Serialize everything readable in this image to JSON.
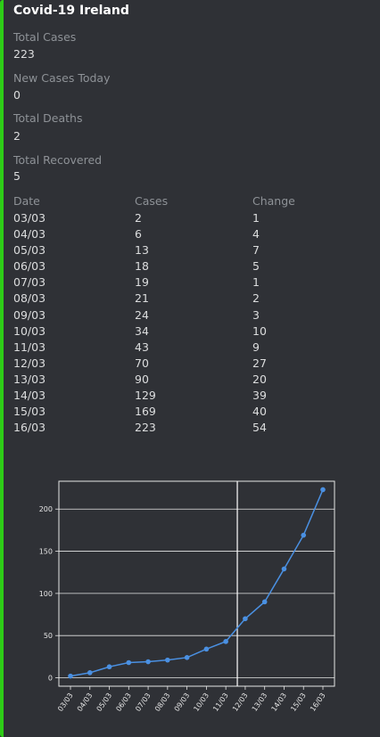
{
  "colors": {
    "accent": "#2ecc17",
    "background": "#2f3136",
    "field_label": "#8e9297",
    "text": "#dcddde",
    "line": "#4a90e2"
  },
  "embed": {
    "title": "Covid-19 Ireland",
    "fields": [
      {
        "name": "Total Cases",
        "value": "223"
      },
      {
        "name": "New Cases Today",
        "value": "0"
      },
      {
        "name": "Total Deaths",
        "value": "2"
      },
      {
        "name": "Total Recovered",
        "value": "5"
      }
    ],
    "table": {
      "headers": [
        "Date",
        "Cases",
        "Change"
      ],
      "dates": [
        "03/03",
        "04/03",
        "05/03",
        "06/03",
        "07/03",
        "08/03",
        "09/03",
        "10/03",
        "11/03",
        "12/03",
        "13/03",
        "14/03",
        "15/03",
        "16/03"
      ],
      "cases": [
        "2",
        "6",
        "13",
        "18",
        "19",
        "21",
        "24",
        "34",
        "43",
        "70",
        "90",
        "129",
        "169",
        "223"
      ],
      "change": [
        "1",
        "4",
        "7",
        "5",
        "1",
        "2",
        "3",
        "10",
        "9",
        "27",
        "20",
        "39",
        "40",
        "54"
      ]
    }
  },
  "chart_data": {
    "type": "line",
    "categories": [
      "03/03",
      "04/03",
      "05/03",
      "06/03",
      "07/03",
      "08/03",
      "09/03",
      "10/03",
      "11/03",
      "12/03",
      "13/03",
      "14/03",
      "15/03",
      "16/03"
    ],
    "values": [
      2,
      6,
      13,
      18,
      19,
      21,
      24,
      34,
      43,
      70,
      90,
      129,
      169,
      223
    ],
    "yticks": [
      0,
      50,
      100,
      150,
      200
    ],
    "ylim": [
      -10,
      233
    ],
    "grid": "horizontal",
    "vertical_marker_category": "12/03",
    "title": "",
    "xlabel": "",
    "ylabel": ""
  }
}
